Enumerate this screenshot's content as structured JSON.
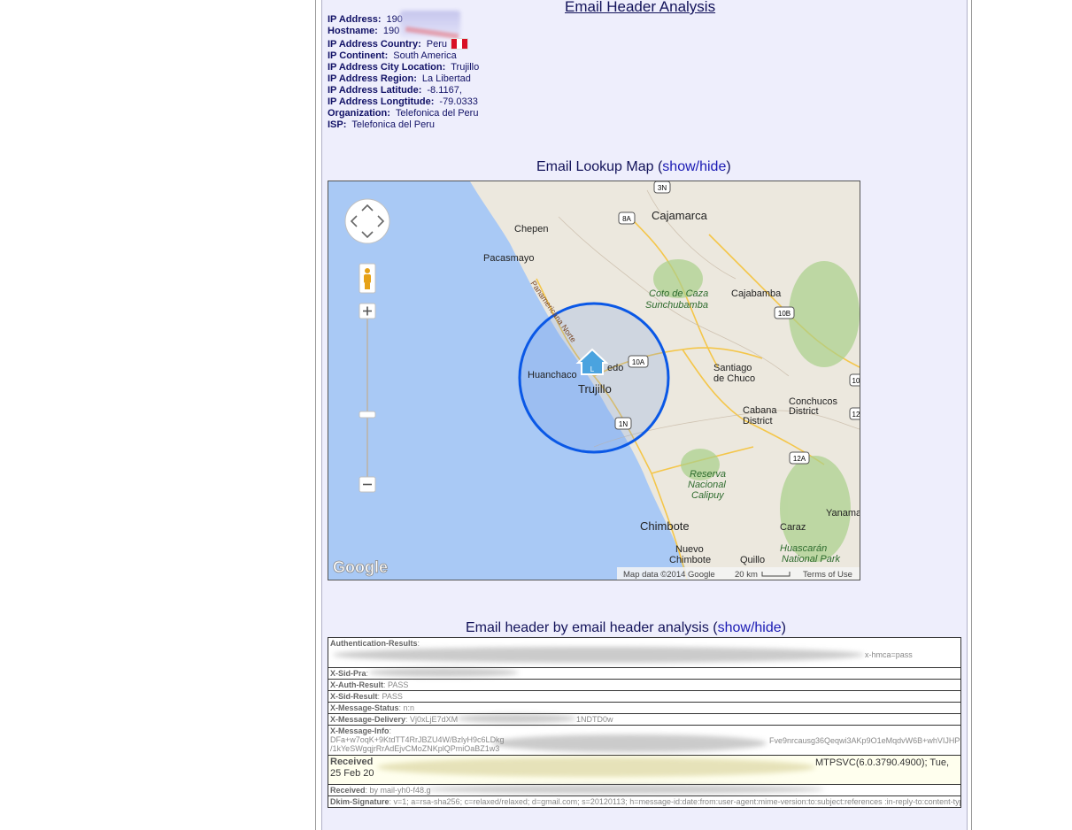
{
  "page": {
    "title": "Email Header Analysis"
  },
  "ip_info": [
    {
      "label": "IP Address:",
      "value": "190"
    },
    {
      "label": "Hostname:",
      "value": "190"
    },
    {
      "label": "IP Address Country:",
      "value": "Peru"
    },
    {
      "label": "IP Continent:",
      "value": "South America"
    },
    {
      "label": "IP Address City Location:",
      "value": "Trujillo"
    },
    {
      "label": "IP Address Region:",
      "value": "La Libertad"
    },
    {
      "label": "IP Address Latitude:",
      "value": "-8.1167,"
    },
    {
      "label": "IP Address Longtitude:",
      "value": "-79.0333"
    },
    {
      "label": "Organization:",
      "value": "Telefonica del Peru"
    },
    {
      "label": "ISP:",
      "value": "Telefonica del Peru"
    }
  ],
  "flag_colors": [
    "#d91023",
    "#ffffff",
    "#d91023"
  ],
  "map_section": {
    "title": "Email Lookup Map (",
    "link": "show/hide",
    "close": ")"
  },
  "map": {
    "attribution": "Map data ©2014 Google",
    "scale": "20 km",
    "terms": "Terms of Use",
    "logo": "Google",
    "places": {
      "chepen": "Chepen",
      "cajamarca": "Cajamarca",
      "pacasmayo": "Pacasmayo",
      "coto1": "Coto de Caza",
      "coto2": "Sunchubamba",
      "cajabamba": "Cajabamba",
      "panam": "Panamericana Norte",
      "huanchaco": "Huanchaco",
      "trujillo": "Trujillo",
      "edo": "edo",
      "santiago1": "Santiago",
      "santiago2": "de Chuco",
      "cabana1": "Cabana",
      "cabana2": "District",
      "conchucos1": "Conchucos",
      "conchucos2": "District",
      "reserva1": "Reserva",
      "reserva2": "Nacional",
      "reserva3": "Calipuy",
      "chimbote": "Chimbote",
      "nuevo1": "Nuevo",
      "nuevo2": "Chimbote",
      "quillo": "Quillo",
      "caraz": "Caraz",
      "yanama": "Yanama",
      "huasc1": "Huascarán",
      "huasc2": "National Park"
    },
    "shields": {
      "3n": "3N",
      "8a": "8A",
      "10b": "10B",
      "10a": "10A",
      "1n": "1N",
      "12a": "12A",
      "12": "12",
      "10": "10"
    }
  },
  "header_section": {
    "title": "Email header by email header analysis (",
    "link": "show/hide",
    "close": ")"
  },
  "headers": [
    {
      "key": "Authentication-Results",
      "value": ":",
      "tail": "x-hmca=pass"
    },
    {
      "key": "X-Sid-Pra",
      "value": ":"
    },
    {
      "key": "X-Auth-Result",
      "value": ": PASS"
    },
    {
      "key": "X-Sid-Result",
      "value": ": PASS"
    },
    {
      "key": "X-Message-Status",
      "value": ": n:n"
    },
    {
      "key": "X-Message-Delivery",
      "value": ": Vj0xLjE7dXM",
      "tail": "1NDTD0w"
    },
    {
      "key": "X-Message-Info",
      "value": ":",
      "line2": "DFa+w7oqK+9KtdTT4RrJBZU4W/BzlyH9c6LDkg",
      "tail2": "Fve9nrcausg36Qeqwi3AKp9O1eMqdvW6B+whVIJHP",
      "line3": "/1kYeSWgqjrRrAdEjvCMoZNKplQPmiOaBZ1w3"
    },
    {
      "key": "Received",
      "value": "",
      "tail": "MTPSVC(6.0.3790.4900); Tue,",
      "line2": "25 Feb 20"
    },
    {
      "key": "Received",
      "value": ": by mail-yh0-f48.g"
    },
    {
      "key": "Dkim-Signature",
      "value": ": v=1; a=rsa-sha256; c=relaxed/relaxed; d=gmail.com; s=20120113; h=message-id:date:from:user-agent:mime-version:to:subject:references :in-reply-to:content-type;"
    }
  ]
}
